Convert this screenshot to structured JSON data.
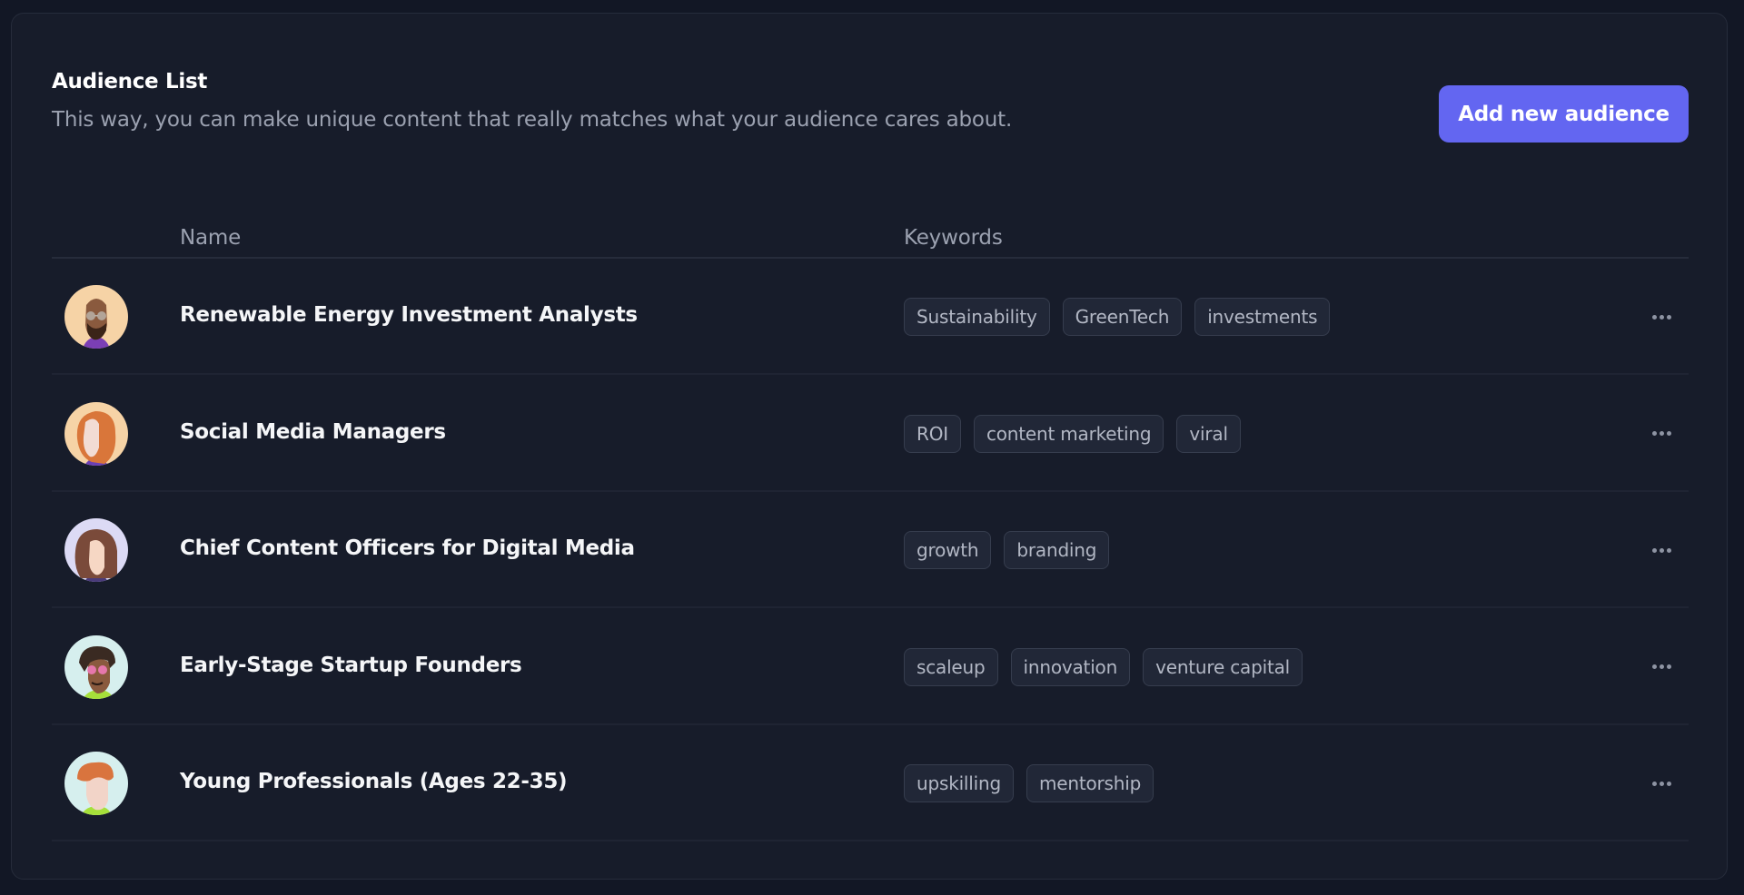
{
  "header": {
    "title": "Audience List",
    "subtitle": "This way, you can make unique content that really matches what your audience cares about.",
    "add_button_label": "Add new audience"
  },
  "colors": {
    "accent": "#6366f1",
    "page_bg": "#121725",
    "card_bg": "#171c2a",
    "tag_bg": "#212737",
    "tag_border": "#363d4e"
  },
  "table": {
    "columns": [
      "",
      "Name",
      "Keywords",
      ""
    ],
    "rows": [
      {
        "avatar": "avatar-man-beard-glasses",
        "name": "Renewable Energy Investment Analysts",
        "keywords": [
          "Sustainability",
          "GreenTech",
          "investments"
        ],
        "menu_icon": "more-horizontal-icon"
      },
      {
        "avatar": "avatar-woman-curly-red-hair",
        "name": "Social Media Managers",
        "keywords": [
          "ROI",
          "content marketing",
          "viral"
        ],
        "menu_icon": "more-horizontal-icon"
      },
      {
        "avatar": "avatar-woman-long-brown-hair",
        "name": "Chief Content Officers for Digital Media",
        "keywords": [
          "growth",
          "branding"
        ],
        "menu_icon": "more-horizontal-icon"
      },
      {
        "avatar": "avatar-man-dreadlocks-pink-glasses",
        "name": "Early-Stage Startup Founders",
        "keywords": [
          "scaleup",
          "innovation",
          "venture capital"
        ],
        "menu_icon": "more-horizontal-icon"
      },
      {
        "avatar": "avatar-man-red-curly-hair",
        "name": "Young Professionals (Ages 22-35)",
        "keywords": [
          "upskilling",
          "mentorship"
        ],
        "menu_icon": "more-horizontal-icon"
      }
    ]
  }
}
